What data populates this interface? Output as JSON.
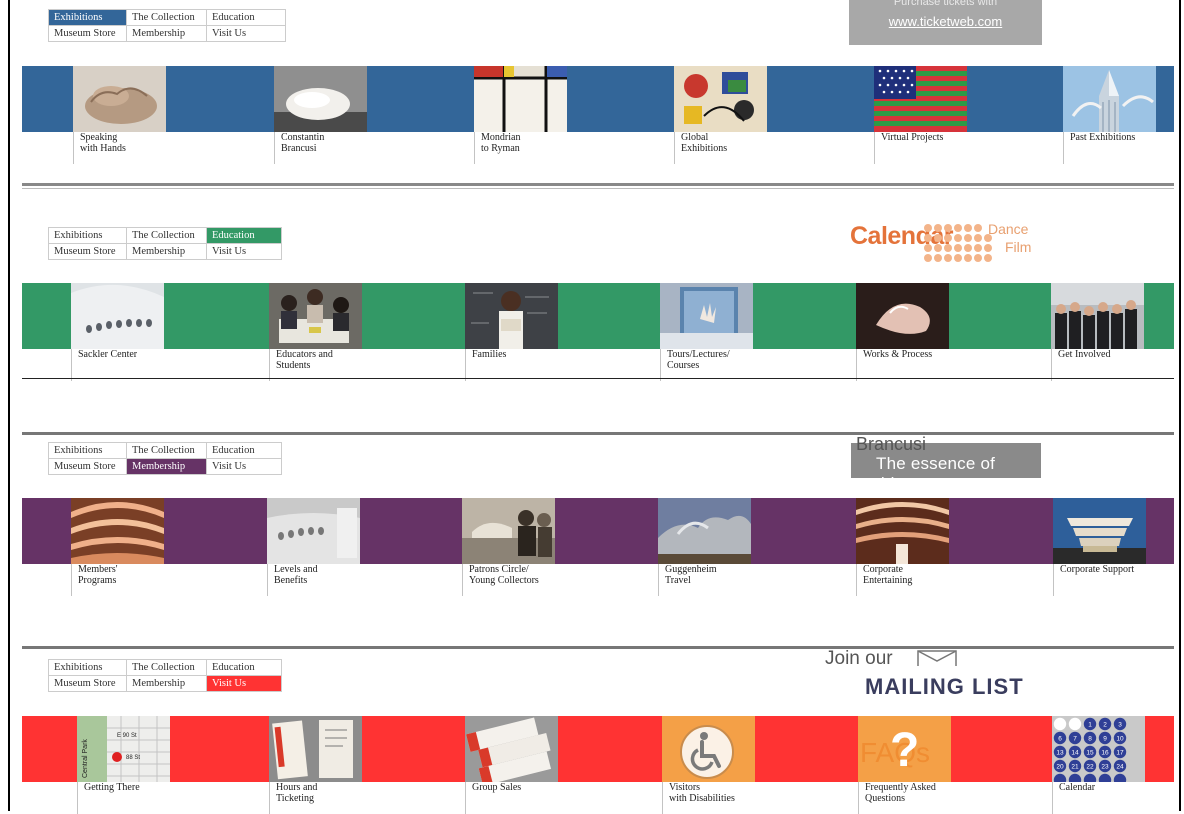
{
  "nav": {
    "exhibitions": "Exhibitions",
    "collection": "The Collection",
    "education": "Education",
    "store": "Museum Store",
    "membership": "Membership",
    "visit": "Visit Us"
  },
  "colors": {
    "exhibitions": "#336699",
    "education": "#339966",
    "membership": "#663366",
    "visit": "#ff3333"
  },
  "promos": {
    "ticket": {
      "cut_text": "Purchase tickets with",
      "link": "www.ticketweb.com"
    },
    "calendar": {
      "title": "Calendar",
      "dance": "Dance",
      "film": "Film"
    },
    "brancusi": {
      "cut_text": "Brancusi",
      "tagline": "The essence of things"
    },
    "mailing": {
      "join": "Join our",
      "list": "MAILING LIST"
    }
  },
  "sections": {
    "exhibitions": {
      "items": [
        {
          "label": "Speaking\nwith Hands",
          "icon": "sculpture-hand-thumb"
        },
        {
          "label": "Constantin\nBrancusi",
          "icon": "sculpture-head-thumb"
        },
        {
          "label": "Mondrian\nto Ryman",
          "icon": "mondrian-thumb"
        },
        {
          "label": "Global\nExhibitions",
          "icon": "miro-thumb"
        },
        {
          "label": "Virtual Projects",
          "icon": "flag-thumb"
        },
        {
          "label": "Past Exhibitions",
          "icon": "building-thumb"
        }
      ]
    },
    "education": {
      "items": [
        {
          "label": "Sackler Center",
          "icon": "sackler-thumb"
        },
        {
          "label": "Educators and\nStudents",
          "icon": "classroom-thumb"
        },
        {
          "label": "Families",
          "icon": "child-reading-thumb"
        },
        {
          "label": "Tours/Lectures/\nCourses",
          "icon": "window-thumb"
        },
        {
          "label": "Works & Process",
          "icon": "performance-thumb"
        },
        {
          "label": "Get Involved",
          "icon": "group-photo-thumb"
        }
      ]
    },
    "membership": {
      "items": [
        {
          "label": "Members'\nPrograms",
          "icon": "rotunda-thumb"
        },
        {
          "label": "Levels and\nBenefits",
          "icon": "gallery-thumb"
        },
        {
          "label": "Patrons Circle/\nYoung Collectors",
          "icon": "patrons-thumb"
        },
        {
          "label": "Guggenheim\nTravel",
          "icon": "bilbao-thumb"
        },
        {
          "label": "Corporate\nEntertaining",
          "icon": "atrium-thumb"
        },
        {
          "label": "Corporate Support",
          "icon": "museum-exterior-thumb"
        }
      ]
    },
    "visit": {
      "items": [
        {
          "label": "Getting There",
          "icon": "map-thumb"
        },
        {
          "label": "Hours and\nTicketing",
          "icon": "ticket-thumb"
        },
        {
          "label": "Group Sales",
          "icon": "tickets-stack-thumb"
        },
        {
          "label": "Visitors\nwith Disabilities",
          "icon": "accessibility-icon"
        },
        {
          "label": "Frequently Asked\nQuestions",
          "icon": "faq-icon"
        },
        {
          "label": "Calendar",
          "icon": "calendar-dots-icon"
        }
      ],
      "map": {
        "street1": "E 90 St",
        "street2": "88 St",
        "park": "Central Park"
      },
      "faq": "FAQs",
      "calendar_days": [
        "1",
        "2",
        "3",
        "6",
        "7",
        "8",
        "9",
        "10",
        "13",
        "14",
        "15",
        "16",
        "17",
        "20",
        "21",
        "22",
        "23",
        "24"
      ]
    }
  }
}
